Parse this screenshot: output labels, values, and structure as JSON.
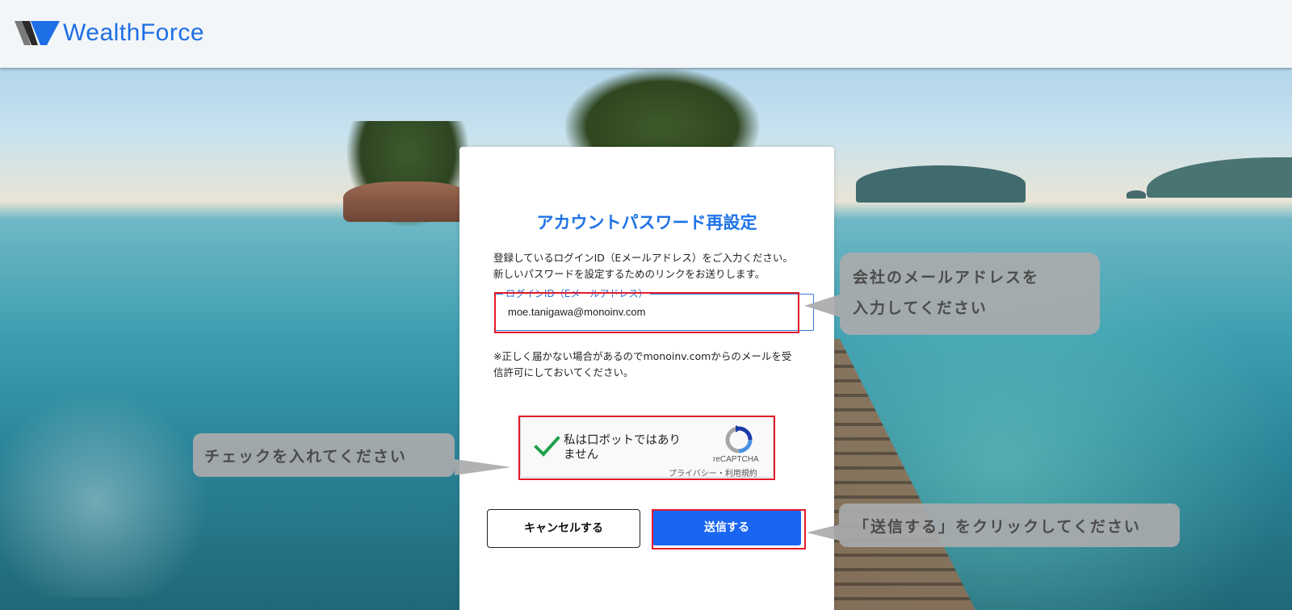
{
  "header": {
    "brand_name": "WealthForce"
  },
  "form": {
    "title": "アカウントパスワード再設定",
    "intro_line1": "登録しているログインID（Eメールアドレス）をご入力ください。",
    "intro_line2": "新しいパスワードを設定するためのリンクをお送りします。",
    "email_label": "ログインID（Eメールアドレス）",
    "email_value": "moe.tanigawa@monoinv.com",
    "note_line1": "※正しく届かない場合があるのでmonoinv.comからのメールを受",
    "note_line2": "信許可にしておいてください。",
    "cancel_label": "キャンセルする",
    "submit_label": "送信する"
  },
  "captcha": {
    "label": "私は口ボットではありません",
    "brand": "reCAPTCHA",
    "privacy_link": "プライバシー",
    "separator": "・",
    "terms_link": "利用規約",
    "checked": true
  },
  "callouts": {
    "email_hint_line1": "会社のメールアドレスを",
    "email_hint_line2": "入力してください",
    "captcha_hint": "チェックを入れてください",
    "submit_hint": "「送信する」をクリックしてください"
  },
  "colors": {
    "brand_blue": "#1e6fe6",
    "submit_blue": "#1a66f2",
    "highlight_red": "#e41a2a",
    "callout_gray": "#aaaaac"
  }
}
